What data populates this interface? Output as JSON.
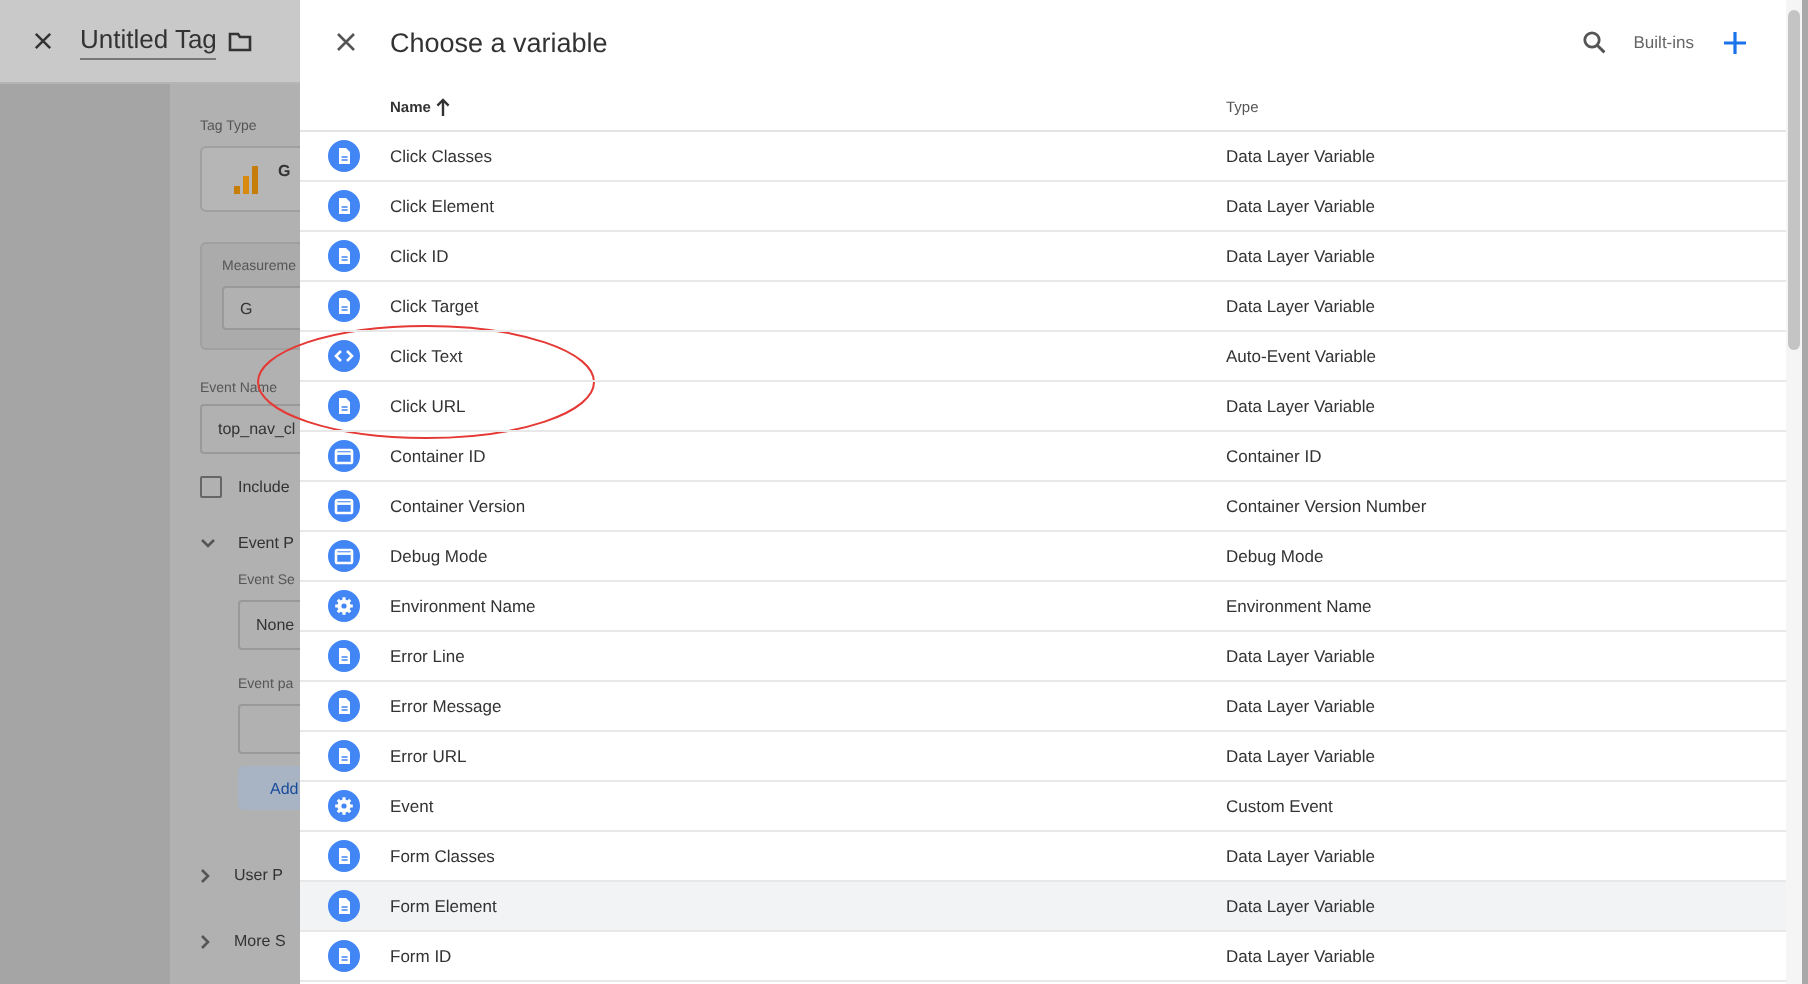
{
  "background_page": {
    "title": "Untitled Tag",
    "tag_type_label": "Tag Type",
    "tag_type_name": "G",
    "measurement_label": "Measureme",
    "measurement_value": "G",
    "event_name_label": "Event Name",
    "event_name_value": "top_nav_cl",
    "include_label": "Include",
    "include_checked": false,
    "event_section": "Event P",
    "event_settings_label": "Event Se",
    "event_settings_value": "None",
    "event_params_label": "Event pa",
    "add_button": "Add",
    "user_section": "User P",
    "more_section": "More S"
  },
  "panel": {
    "title": "Choose a variable",
    "builtins": "Built-ins",
    "columns": [
      {
        "label": "Name",
        "sorted": true
      },
      {
        "label": "Type",
        "sorted": false
      }
    ],
    "rows": [
      {
        "name": "Click Classes",
        "type": "Data Layer Variable",
        "kind": "document",
        "selected": false,
        "circled": false
      },
      {
        "name": "Click Element",
        "type": "Data Layer Variable",
        "kind": "document",
        "selected": false,
        "circled": false
      },
      {
        "name": "Click ID",
        "type": "Data Layer Variable",
        "kind": "document",
        "selected": false,
        "circled": false
      },
      {
        "name": "Click Target",
        "type": "Data Layer Variable",
        "kind": "document",
        "selected": false,
        "circled": false
      },
      {
        "name": "Click Text",
        "type": "Auto-Event Variable",
        "kind": "code",
        "selected": false,
        "circled": true
      },
      {
        "name": "Click URL",
        "type": "Data Layer Variable",
        "kind": "document",
        "selected": false,
        "circled": true
      },
      {
        "name": "Container ID",
        "type": "Container ID",
        "kind": "window",
        "selected": false,
        "circled": false
      },
      {
        "name": "Container Version",
        "type": "Container Version Number",
        "kind": "window",
        "selected": false,
        "circled": false
      },
      {
        "name": "Debug Mode",
        "type": "Debug Mode",
        "kind": "window",
        "selected": false,
        "circled": false
      },
      {
        "name": "Environment Name",
        "type": "Environment Name",
        "kind": "gear",
        "selected": false,
        "circled": false
      },
      {
        "name": "Error Line",
        "type": "Data Layer Variable",
        "kind": "document",
        "selected": false,
        "circled": false
      },
      {
        "name": "Error Message",
        "type": "Data Layer Variable",
        "kind": "document",
        "selected": false,
        "circled": false
      },
      {
        "name": "Error URL",
        "type": "Data Layer Variable",
        "kind": "document",
        "selected": false,
        "circled": false
      },
      {
        "name": "Event",
        "type": "Custom Event",
        "kind": "gear",
        "selected": false,
        "circled": false
      },
      {
        "name": "Form Classes",
        "type": "Data Layer Variable",
        "kind": "document",
        "selected": false,
        "circled": false
      },
      {
        "name": "Form Element",
        "type": "Data Layer Variable",
        "kind": "document",
        "selected": true,
        "circled": false
      },
      {
        "name": "Form ID",
        "type": "Data Layer Variable",
        "kind": "document",
        "selected": false,
        "circled": false
      }
    ]
  }
}
